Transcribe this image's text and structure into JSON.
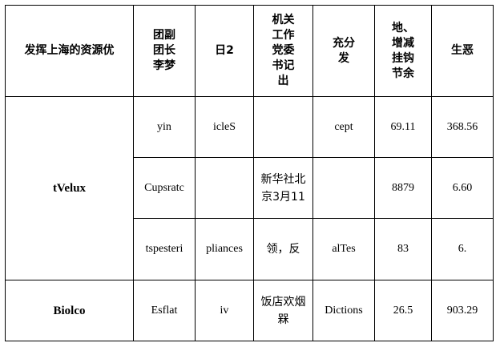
{
  "table": {
    "headers": [
      "发挥上海的资源优",
      "团副\n团长\n李梦",
      "日2",
      "机关\n工作\n党委\n书记\n出",
      "充分\n发",
      "地、\n增减\n挂钩\n节余",
      "生恶"
    ],
    "groups": [
      {
        "name": "tVelux",
        "rows": [
          [
            "yin",
            "icleS",
            "",
            "cept",
            "69.11",
            "368.56"
          ],
          [
            "Cupsratc",
            "",
            "新华社北\n京3月11",
            "",
            "8879",
            "6.60"
          ],
          [
            "tspesteri",
            "pliances",
            "领，反",
            "alTes",
            "83",
            "6."
          ]
        ]
      },
      {
        "name": "Biolco",
        "rows": [
          [
            "Esflat",
            "iv",
            "饭店欢烟\n槑",
            "Dictions",
            "26.5",
            "903.29"
          ]
        ]
      }
    ]
  }
}
